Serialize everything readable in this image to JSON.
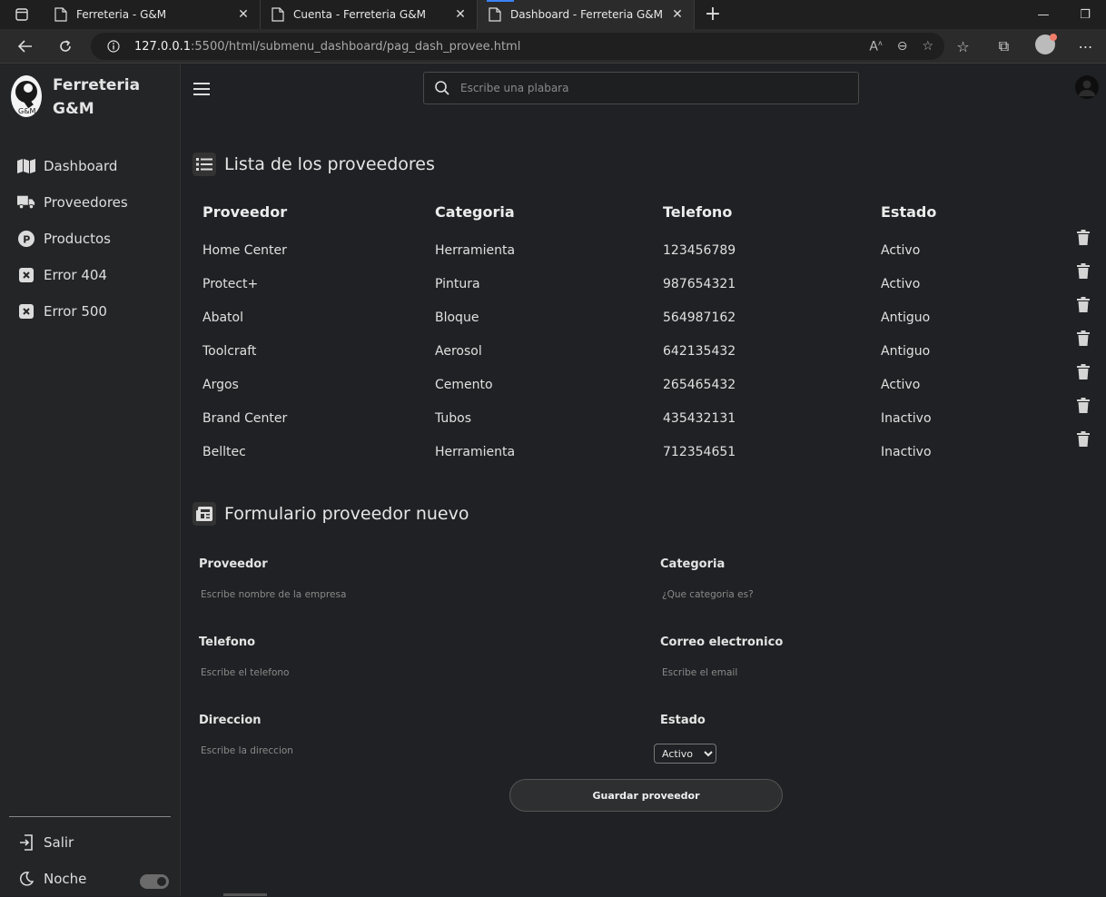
{
  "browser": {
    "tabs": [
      {
        "title": "Ferreteria - G&M",
        "active": false
      },
      {
        "title": "Cuenta - Ferreteria G&M",
        "active": false
      },
      {
        "title": "Dashboard - Ferreteria G&M",
        "active": true
      }
    ],
    "url_host": "127.0.0.1",
    "url_rest": ":5500/html/submenu_dashboard/pag_dash_provee.html",
    "new_tab": "+",
    "close_glyph": "✕"
  },
  "sidebar": {
    "brand": "Ferreteria G&M",
    "items": [
      {
        "label": "Dashboard",
        "icon": "map-icon"
      },
      {
        "label": "Proveedores",
        "icon": "truck-icon"
      },
      {
        "label": "Productos",
        "icon": "product-icon"
      },
      {
        "label": "Error 404",
        "icon": "error-icon"
      },
      {
        "label": "Error 500",
        "icon": "error-icon"
      }
    ],
    "logout": "Salir",
    "night": "Noche",
    "night_mode_on": true
  },
  "header": {
    "search_placeholder": "Escribe una plabara"
  },
  "list": {
    "title": "Lista de los proveedores",
    "columns": [
      "Proveedor",
      "Categoria",
      "Telefono",
      "Estado"
    ],
    "rows": [
      [
        "Home Center",
        "Herramienta",
        "123456789",
        "Activo"
      ],
      [
        "Protect+",
        "Pintura",
        "987654321",
        "Activo"
      ],
      [
        "Abatol",
        "Bloque",
        "564987162",
        "Antiguo"
      ],
      [
        "Toolcraft",
        "Aerosol",
        "642135432",
        "Antiguo"
      ],
      [
        "Argos",
        "Cemento",
        "265465432",
        "Activo"
      ],
      [
        "Brand Center",
        "Tubos",
        "435432131",
        "Inactivo"
      ],
      [
        "Belltec",
        "Herramienta",
        "712354651",
        "Inactivo"
      ]
    ]
  },
  "form": {
    "title": "Formulario proveedor nuevo",
    "proveedor_label": "Proveedor",
    "proveedor_placeholder": "Escribe nombre de la empresa",
    "categoria_label": "Categoria",
    "categoria_placeholder": "¿Que categoria es?",
    "telefono_label": "Telefono",
    "telefono_placeholder": "Escribe el telefono",
    "correo_label": "Correo electronico",
    "correo_placeholder": "Escribe el email",
    "direccion_label": "Direccion",
    "direccion_placeholder": "Escribe la direccion",
    "estado_label": "Estado",
    "estado_value": "Activo",
    "save_label": "Guardar proveedor"
  }
}
